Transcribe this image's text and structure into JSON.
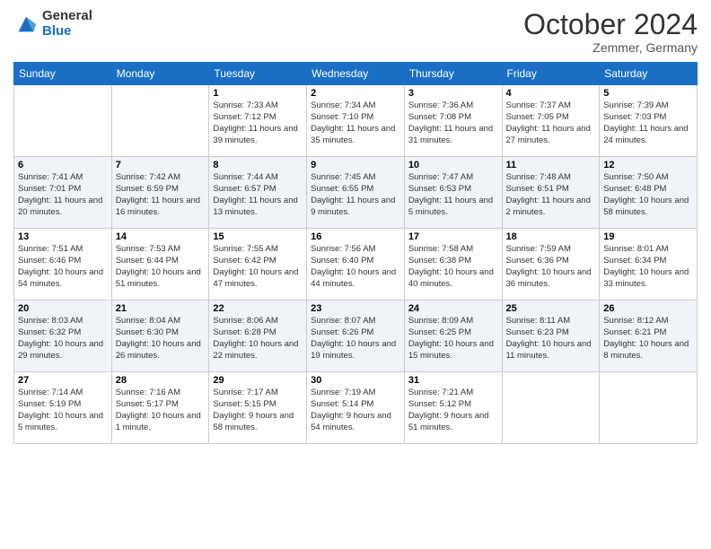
{
  "logo": {
    "general": "General",
    "blue": "Blue"
  },
  "header": {
    "month": "October 2024",
    "location": "Zemmer, Germany"
  },
  "weekdays": [
    "Sunday",
    "Monday",
    "Tuesday",
    "Wednesday",
    "Thursday",
    "Friday",
    "Saturday"
  ],
  "weeks": [
    [
      {
        "day": "",
        "info": ""
      },
      {
        "day": "",
        "info": ""
      },
      {
        "day": "1",
        "info": "Sunrise: 7:33 AM\nSunset: 7:12 PM\nDaylight: 11 hours and 39 minutes."
      },
      {
        "day": "2",
        "info": "Sunrise: 7:34 AM\nSunset: 7:10 PM\nDaylight: 11 hours and 35 minutes."
      },
      {
        "day": "3",
        "info": "Sunrise: 7:36 AM\nSunset: 7:08 PM\nDaylight: 11 hours and 31 minutes."
      },
      {
        "day": "4",
        "info": "Sunrise: 7:37 AM\nSunset: 7:05 PM\nDaylight: 11 hours and 27 minutes."
      },
      {
        "day": "5",
        "info": "Sunrise: 7:39 AM\nSunset: 7:03 PM\nDaylight: 11 hours and 24 minutes."
      }
    ],
    [
      {
        "day": "6",
        "info": "Sunrise: 7:41 AM\nSunset: 7:01 PM\nDaylight: 11 hours and 20 minutes."
      },
      {
        "day": "7",
        "info": "Sunrise: 7:42 AM\nSunset: 6:59 PM\nDaylight: 11 hours and 16 minutes."
      },
      {
        "day": "8",
        "info": "Sunrise: 7:44 AM\nSunset: 6:57 PM\nDaylight: 11 hours and 13 minutes."
      },
      {
        "day": "9",
        "info": "Sunrise: 7:45 AM\nSunset: 6:55 PM\nDaylight: 11 hours and 9 minutes."
      },
      {
        "day": "10",
        "info": "Sunrise: 7:47 AM\nSunset: 6:53 PM\nDaylight: 11 hours and 5 minutes."
      },
      {
        "day": "11",
        "info": "Sunrise: 7:48 AM\nSunset: 6:51 PM\nDaylight: 11 hours and 2 minutes."
      },
      {
        "day": "12",
        "info": "Sunrise: 7:50 AM\nSunset: 6:48 PM\nDaylight: 10 hours and 58 minutes."
      }
    ],
    [
      {
        "day": "13",
        "info": "Sunrise: 7:51 AM\nSunset: 6:46 PM\nDaylight: 10 hours and 54 minutes."
      },
      {
        "day": "14",
        "info": "Sunrise: 7:53 AM\nSunset: 6:44 PM\nDaylight: 10 hours and 51 minutes."
      },
      {
        "day": "15",
        "info": "Sunrise: 7:55 AM\nSunset: 6:42 PM\nDaylight: 10 hours and 47 minutes."
      },
      {
        "day": "16",
        "info": "Sunrise: 7:56 AM\nSunset: 6:40 PM\nDaylight: 10 hours and 44 minutes."
      },
      {
        "day": "17",
        "info": "Sunrise: 7:58 AM\nSunset: 6:38 PM\nDaylight: 10 hours and 40 minutes."
      },
      {
        "day": "18",
        "info": "Sunrise: 7:59 AM\nSunset: 6:36 PM\nDaylight: 10 hours and 36 minutes."
      },
      {
        "day": "19",
        "info": "Sunrise: 8:01 AM\nSunset: 6:34 PM\nDaylight: 10 hours and 33 minutes."
      }
    ],
    [
      {
        "day": "20",
        "info": "Sunrise: 8:03 AM\nSunset: 6:32 PM\nDaylight: 10 hours and 29 minutes."
      },
      {
        "day": "21",
        "info": "Sunrise: 8:04 AM\nSunset: 6:30 PM\nDaylight: 10 hours and 26 minutes."
      },
      {
        "day": "22",
        "info": "Sunrise: 8:06 AM\nSunset: 6:28 PM\nDaylight: 10 hours and 22 minutes."
      },
      {
        "day": "23",
        "info": "Sunrise: 8:07 AM\nSunset: 6:26 PM\nDaylight: 10 hours and 19 minutes."
      },
      {
        "day": "24",
        "info": "Sunrise: 8:09 AM\nSunset: 6:25 PM\nDaylight: 10 hours and 15 minutes."
      },
      {
        "day": "25",
        "info": "Sunrise: 8:11 AM\nSunset: 6:23 PM\nDaylight: 10 hours and 11 minutes."
      },
      {
        "day": "26",
        "info": "Sunrise: 8:12 AM\nSunset: 6:21 PM\nDaylight: 10 hours and 8 minutes."
      }
    ],
    [
      {
        "day": "27",
        "info": "Sunrise: 7:14 AM\nSunset: 5:19 PM\nDaylight: 10 hours and 5 minutes."
      },
      {
        "day": "28",
        "info": "Sunrise: 7:16 AM\nSunset: 5:17 PM\nDaylight: 10 hours and 1 minute."
      },
      {
        "day": "29",
        "info": "Sunrise: 7:17 AM\nSunset: 5:15 PM\nDaylight: 9 hours and 58 minutes."
      },
      {
        "day": "30",
        "info": "Sunrise: 7:19 AM\nSunset: 5:14 PM\nDaylight: 9 hours and 54 minutes."
      },
      {
        "day": "31",
        "info": "Sunrise: 7:21 AM\nSunset: 5:12 PM\nDaylight: 9 hours and 51 minutes."
      },
      {
        "day": "",
        "info": ""
      },
      {
        "day": "",
        "info": ""
      }
    ]
  ]
}
